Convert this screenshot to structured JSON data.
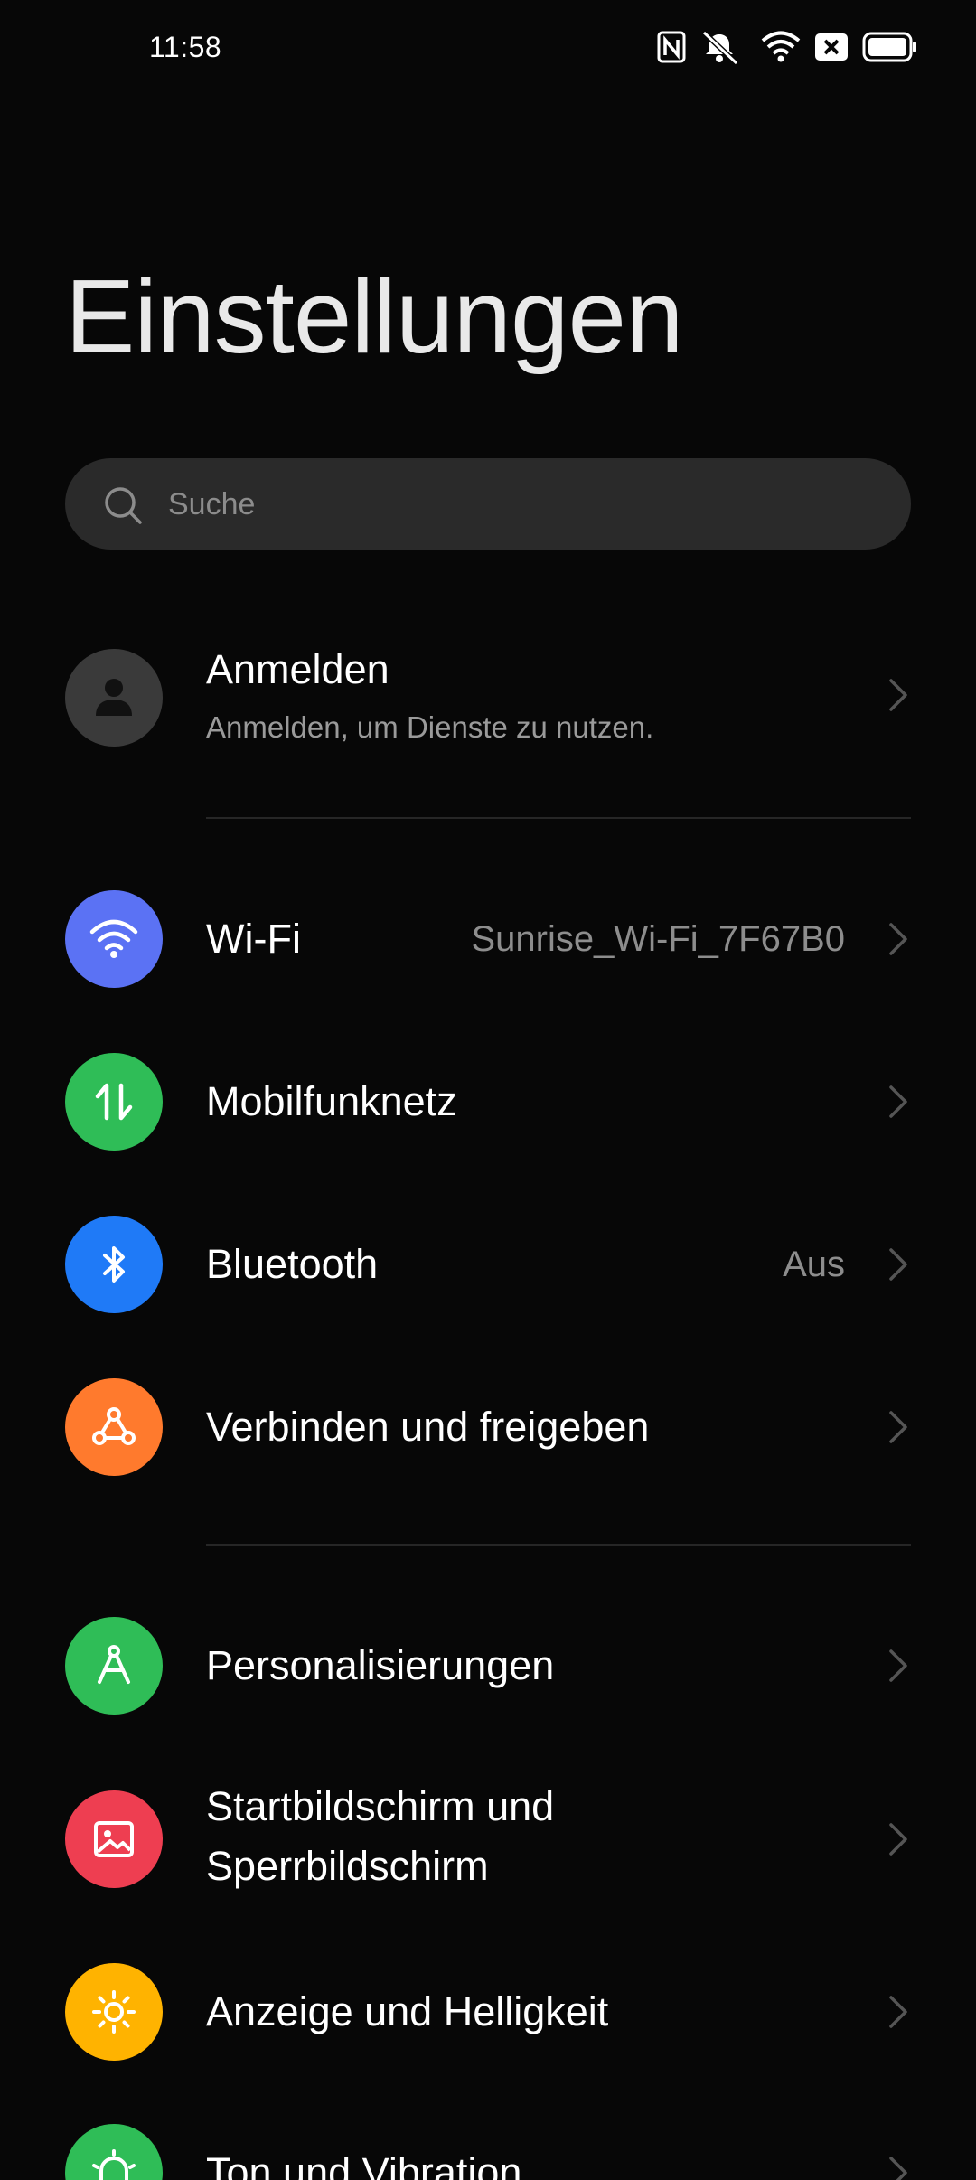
{
  "status_bar": {
    "time": "11:58",
    "icons": [
      "nfc-icon",
      "mute-icon",
      "wifi-icon",
      "sim-blocked-icon",
      "battery-icon"
    ]
  },
  "page": {
    "title": "Einstellungen"
  },
  "search": {
    "placeholder": "Suche"
  },
  "account": {
    "title": "Anmelden",
    "subtitle": "Anmelden, um Dienste zu nutzen."
  },
  "items": [
    {
      "label": "Wi-Fi",
      "value": "Sunrise_Wi-Fi_7F67B0",
      "icon": "wifi-icon",
      "color": "#5b72f4"
    },
    {
      "label": "Mobilfunknetz",
      "value": "",
      "icon": "mobile-data-icon",
      "color": "#2fbd57"
    },
    {
      "label": "Bluetooth",
      "value": "Aus",
      "icon": "bluetooth-icon",
      "color": "#1f7af7"
    },
    {
      "label": "Verbinden und freigeben",
      "value": "",
      "icon": "share-icon",
      "color": "#ff7a2d"
    },
    {
      "label": "Personalisierungen",
      "value": "",
      "icon": "compass-icon",
      "color": "#2fbd57"
    },
    {
      "label": "Startbildschirm und Sperrbildschirm",
      "value": "",
      "icon": "picture-icon",
      "color": "#ee3e51"
    },
    {
      "label": "Anzeige und Helligkeit",
      "value": "",
      "icon": "brightness-icon",
      "color": "#ffb300"
    },
    {
      "label": "Ton und Vibration",
      "value": "",
      "icon": "bell-icon",
      "color": "#2fbd57"
    }
  ]
}
